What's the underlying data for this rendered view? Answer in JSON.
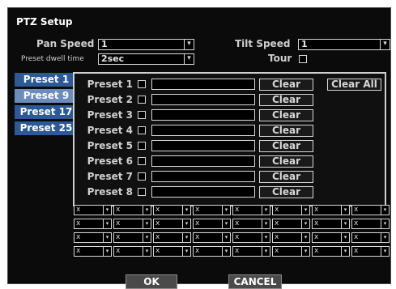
{
  "window": {
    "title": "PTZ Setup"
  },
  "pan_speed": {
    "label": "Pan Speed",
    "value": "1"
  },
  "tilt_speed": {
    "label": "Tilt Speed",
    "value": "1"
  },
  "dwell_time": {
    "label": "Preset dwell time",
    "value": "2sec"
  },
  "tour": {
    "label": "Tour"
  },
  "tabs": [
    "Preset 1",
    "Preset 9",
    "Preset 17",
    "Preset 25"
  ],
  "presets": [
    {
      "label": "Preset 1",
      "clear": "Clear"
    },
    {
      "label": "Preset 2",
      "clear": "Clear"
    },
    {
      "label": "Preset 3",
      "clear": "Clear"
    },
    {
      "label": "Preset 4",
      "clear": "Clear"
    },
    {
      "label": "Preset 5",
      "clear": "Clear"
    },
    {
      "label": "Preset 6",
      "clear": "Clear"
    },
    {
      "label": "Preset 7",
      "clear": "Clear"
    },
    {
      "label": "Preset 8",
      "clear": "Clear"
    }
  ],
  "clear_all": "Clear All",
  "tour_grid": {
    "rows": [
      [
        "x",
        "x",
        "x",
        "x",
        "x",
        "x",
        "x",
        "x"
      ],
      [
        "x",
        "x",
        "x",
        "x",
        "x",
        "x",
        "x",
        "x"
      ],
      [
        "x",
        "x",
        "x",
        "x",
        "x",
        "x",
        "x",
        "x"
      ],
      [
        "x",
        "x",
        "x",
        "x",
        "x",
        "x",
        "x",
        "x"
      ]
    ]
  },
  "buttons": {
    "ok": "OK",
    "cancel": "CANCEL"
  },
  "icons": {
    "dropdown_arrow": "▾"
  }
}
